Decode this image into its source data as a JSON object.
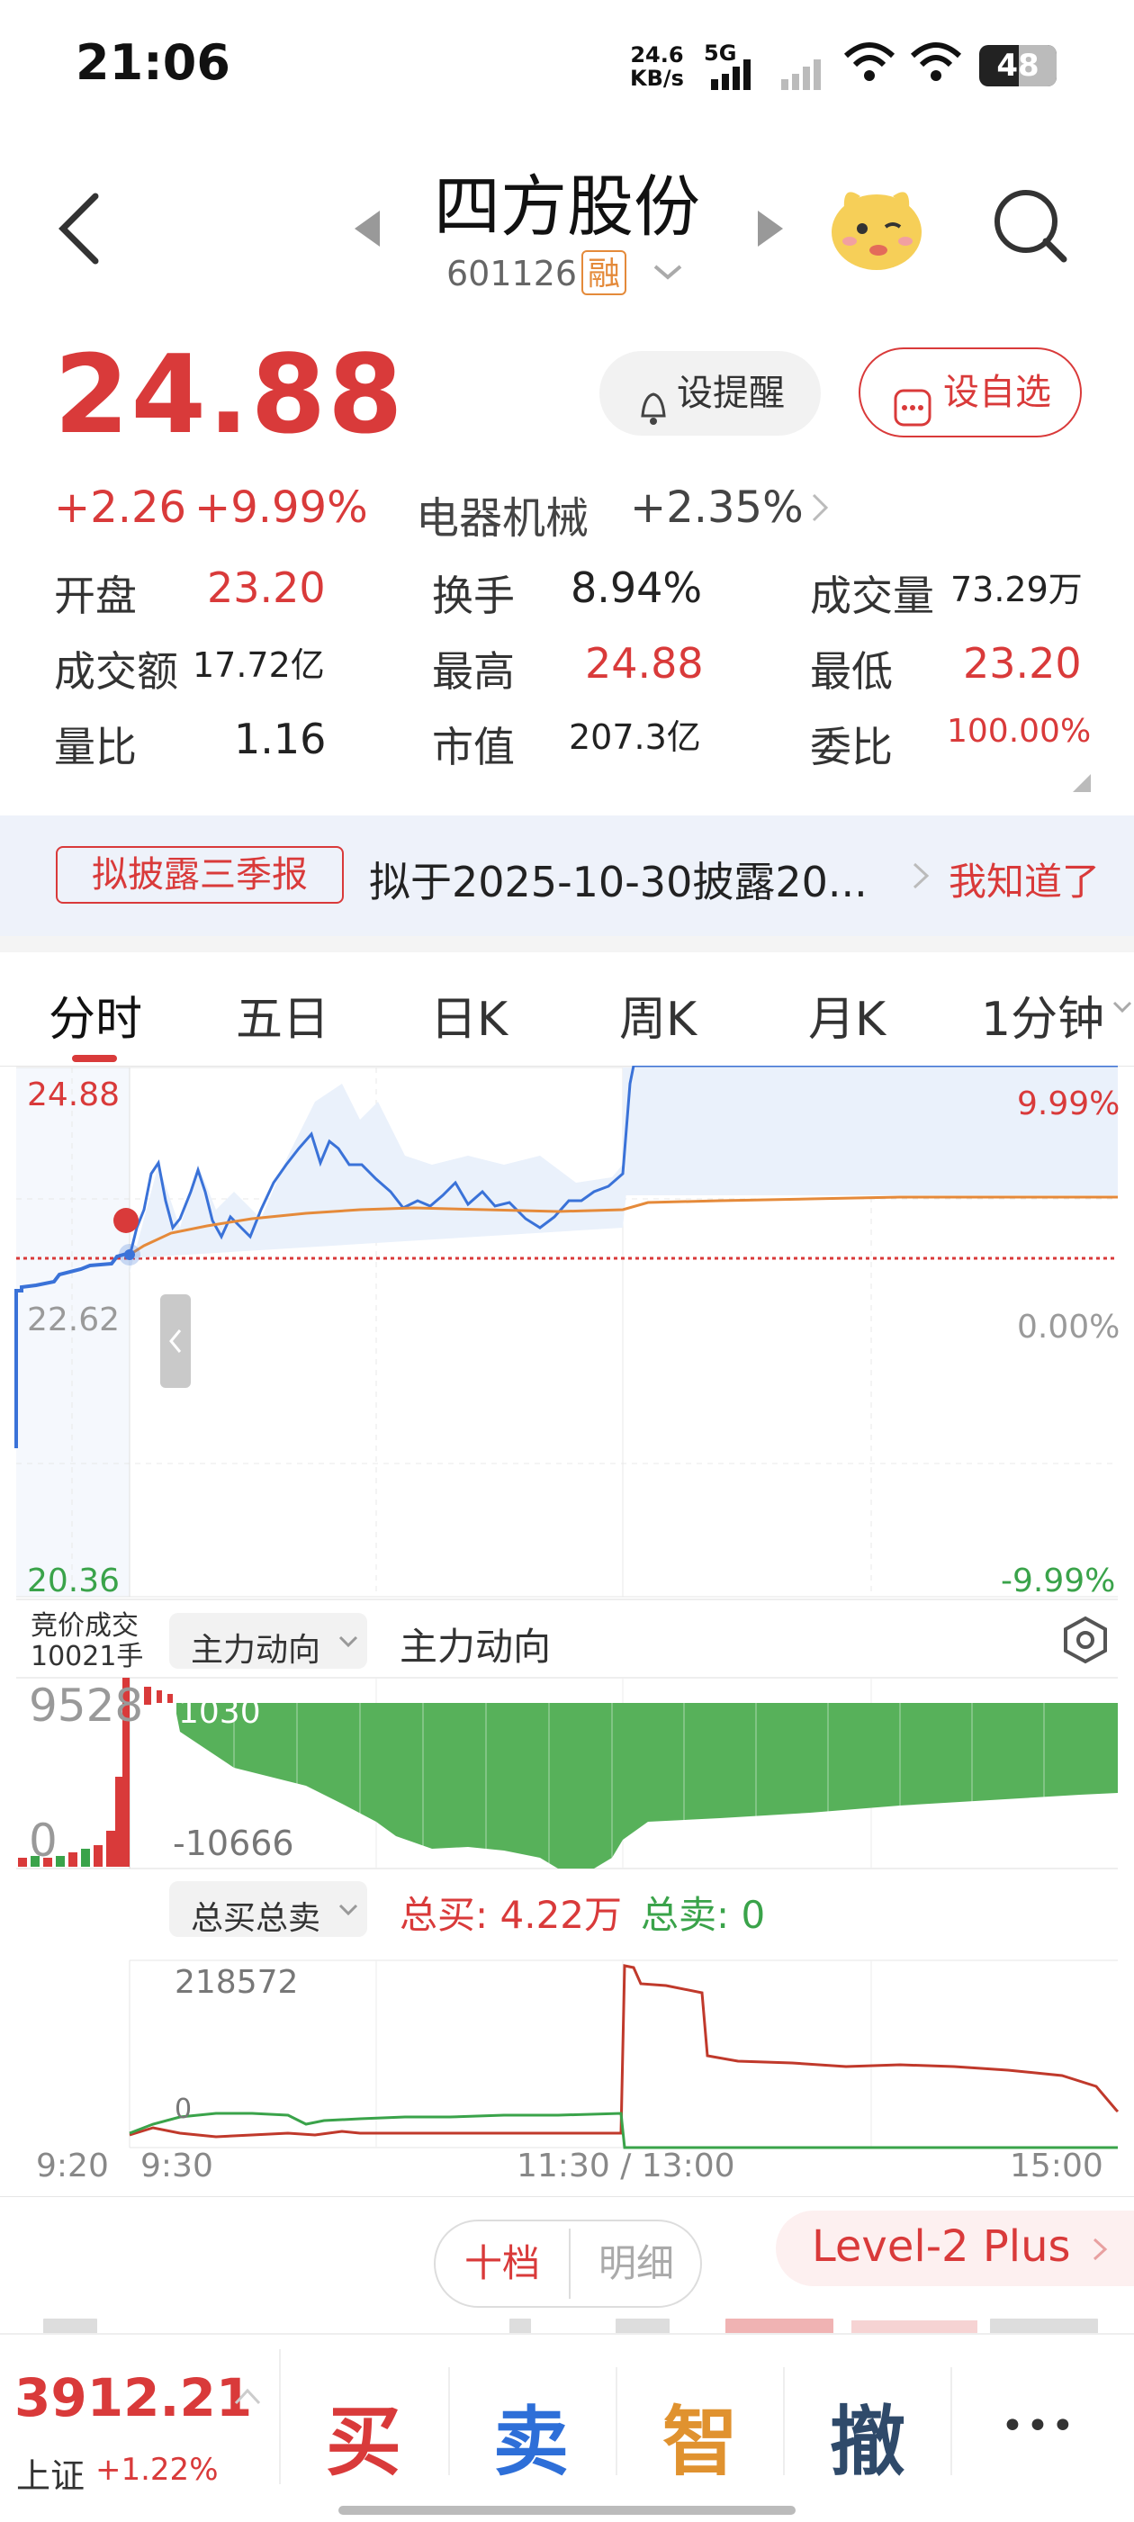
{
  "status_bar": {
    "time": "21:06",
    "net_speed_value": "24.6",
    "net_speed_unit": "KB/s",
    "network": "5G",
    "battery": "48"
  },
  "header": {
    "title": "四方股份",
    "code": "601126",
    "margin_badge": "融"
  },
  "quote": {
    "price": "24.88",
    "change": "+2.26",
    "change_pct": "+9.99%",
    "sector_name": "电器机械",
    "sector_change": "+2.35%",
    "remind_label": "设提醒",
    "watchlist_label": "设自选"
  },
  "stats": {
    "open_label": "开盘",
    "open_value": "23.20",
    "turnover_label": "换手",
    "turnover_value": "8.94%",
    "volume_label": "成交量",
    "volume_value": "73.29万",
    "amount_label": "成交额",
    "amount_value": "17.72亿",
    "high_label": "最高",
    "high_value": "24.88",
    "low_label": "最低",
    "low_value": "23.20",
    "vol_ratio_label": "量比",
    "vol_ratio_value": "1.16",
    "mktcap_label": "市值",
    "mktcap_value": "207.3亿",
    "commission_label": "委比",
    "commission_value": "100.00%"
  },
  "notice": {
    "tag": "拟披露三季报",
    "text": "拟于2025-10-30披露20...",
    "action": "我知道了"
  },
  "tabs": [
    "分时",
    "五日",
    "日K",
    "周K",
    "月K",
    "1分钟"
  ],
  "chart": {
    "left_top": "24.88",
    "left_mid": "22.62",
    "left_bottom": "20.36",
    "right_top": "9.99%",
    "right_mid": "0.00%",
    "right_bottom": "-9.99%",
    "auction_label": "竞价成交",
    "auction_value": "10021手",
    "capital_dropdown": "主力动向",
    "capital_title": "主力动向",
    "capital_pre_max": "9528",
    "capital_pre_zero": "0",
    "capital_max": "1030",
    "capital_min": "-10666",
    "order_dropdown": "总买总卖",
    "total_buy": "总买: 4.22万",
    "total_sell": "总卖: 0",
    "order_max": "218572",
    "order_zero": "0",
    "time_labels": [
      "9:20",
      "9:30",
      "11:30 / 13:00",
      "15:00"
    ]
  },
  "order_book": {
    "tab1": "十档",
    "tab2": "明细",
    "level2": "Level-2 Plus"
  },
  "bottom": {
    "index_value": "3912.21",
    "index_name": "上证",
    "index_change": "+1.22%",
    "buy": "买",
    "sell": "卖",
    "smart": "智",
    "cancel": "撤",
    "more": "•••"
  },
  "colors": {
    "up": "#d93a3a",
    "down": "#3aa34a",
    "price_line": "#3a72d8",
    "avg_line": "#e58a3a",
    "smart": "#e0922f",
    "cancel": "#2f4a6a"
  }
}
